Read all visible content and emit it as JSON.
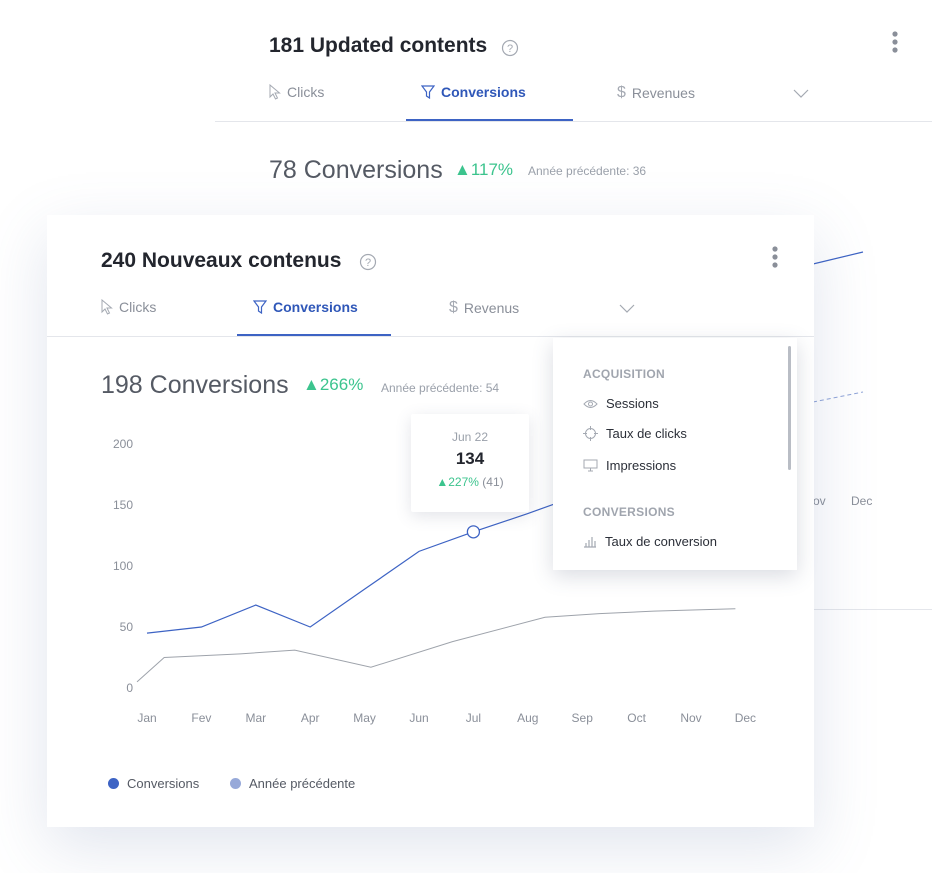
{
  "back_card": {
    "title": "181 Updated contents",
    "tabs": [
      {
        "label": "Clicks",
        "icon": "cursor-icon"
      },
      {
        "label": "Conversions",
        "icon": "filter-icon",
        "active": true
      },
      {
        "label": "Revenues",
        "icon": "dollar-icon"
      }
    ],
    "stat": "78 Conversions",
    "delta": "▲117%",
    "previous": "Année précédente: 36",
    "visible_months": [
      "ov",
      "Dec"
    ]
  },
  "front_card": {
    "title": "240 Nouveaux contenus",
    "tabs": [
      {
        "label": "Clicks",
        "icon": "cursor-icon"
      },
      {
        "label": "Conversions",
        "icon": "filter-icon",
        "active": true
      },
      {
        "label": "Revenus",
        "icon": "dollar-icon"
      }
    ],
    "stat": "198 Conversions",
    "delta": "▲266%",
    "previous": "Année précédente: 54",
    "tooltip": {
      "date": "Jun 22",
      "value": "134",
      "delta": "▲227%",
      "previous": "(41)"
    },
    "legend": [
      {
        "label": "Conversions",
        "color": "#3d63c4"
      },
      {
        "label": "Année précédente",
        "color": "#97a9d9"
      }
    ]
  },
  "dropdown": {
    "groups": [
      {
        "label": "ACQUISITION",
        "items": [
          {
            "label": "Sessions",
            "icon": "eye-icon"
          },
          {
            "label": "Taux de clicks",
            "icon": "crosshair-icon"
          },
          {
            "label": "Impressions",
            "icon": "monitor-icon"
          }
        ]
      },
      {
        "label": "CONVERSIONS",
        "items": [
          {
            "label": "Taux de conversion",
            "icon": "bar-chart-icon"
          }
        ]
      }
    ]
  },
  "chart_data": {
    "type": "line",
    "categories": [
      "Jan",
      "Fev",
      "Mar",
      "Apr",
      "May",
      "Jun",
      "Jul",
      "Aug",
      "Sep",
      "Oct",
      "Nov",
      "Dec"
    ],
    "y_ticks": [
      0,
      50,
      100,
      150,
      200
    ],
    "ylim": [
      0,
      200
    ],
    "series": [
      {
        "name": "Conversions",
        "color": "#3d63c4",
        "values": [
          45,
          50,
          68,
          50,
          81,
          112,
          128,
          143,
          159,
          null,
          null,
          null
        ],
        "x_offset": 0
      },
      {
        "name": "Année précédente",
        "color": "#9ea3ab",
        "values": [
          5,
          25,
          28,
          31,
          17,
          38,
          58,
          61,
          63,
          65
        ],
        "x_positions": [
          0,
          0.5,
          1.9,
          2.9,
          4.3,
          5.8,
          7.5,
          8.5,
          9.5,
          11
        ]
      }
    ],
    "highlight": {
      "category": "Jul",
      "value": 128
    }
  }
}
